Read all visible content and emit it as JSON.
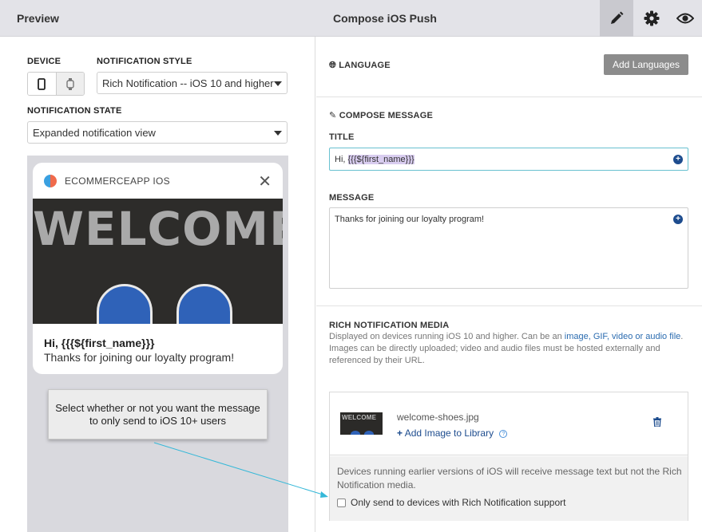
{
  "header": {
    "preview_title": "Preview",
    "compose_title": "Compose iOS Push",
    "actions": [
      "edit-icon",
      "gear-icon",
      "eye-icon"
    ]
  },
  "left": {
    "device_label": "DEVICE",
    "device_options": [
      "phone-icon",
      "watch-icon"
    ],
    "style_label": "NOTIFICATION STYLE",
    "style_value": "Rich Notification -- iOS 10 and higher",
    "state_label": "NOTIFICATION STATE",
    "state_value": "Expanded notification view",
    "notification": {
      "app_name": "ECOMMERCEAPP IOS",
      "close": "✕",
      "image_text": "WELCOME",
      "title": "Hi, {{{${first_name}}}",
      "body": "Thanks for joining our loyalty program!"
    },
    "tooltip": "Select whether or not you want the message to only send to iOS 10+ users"
  },
  "right": {
    "language_label": "LANGUAGE",
    "add_languages": "Add Languages",
    "compose_label": "COMPOSE MESSAGE",
    "title_label": "TITLE",
    "title_prefix": "Hi, ",
    "title_var": "{{{${first_name}}}",
    "message_label": "MESSAGE",
    "message_value": "Thanks for joining our loyalty program!",
    "media_label": "RICH NOTIFICATION MEDIA",
    "media_help_1": "Displayed on devices running iOS 10 and higher. Can be an ",
    "media_help_link": "image, GIF, video or audio file",
    "media_help_2": ". Images can be directly uploaded; video and audio files must be hosted externally and referenced by their URL.",
    "file_name": "welcome-shoes.jpg",
    "add_image": "Add Image to Library",
    "thumb_text": "WELCOME",
    "warning": "Devices running earlier versions of iOS will receive message text but not the Rich Notification media.",
    "checkbox_label": "Only send to devices with Rich Notification support"
  },
  "colors": {
    "topbar": "#e3e3e8",
    "focus_border": "#68c1d0",
    "link": "#1d4c8e",
    "callout_line": "#35b8d8"
  }
}
